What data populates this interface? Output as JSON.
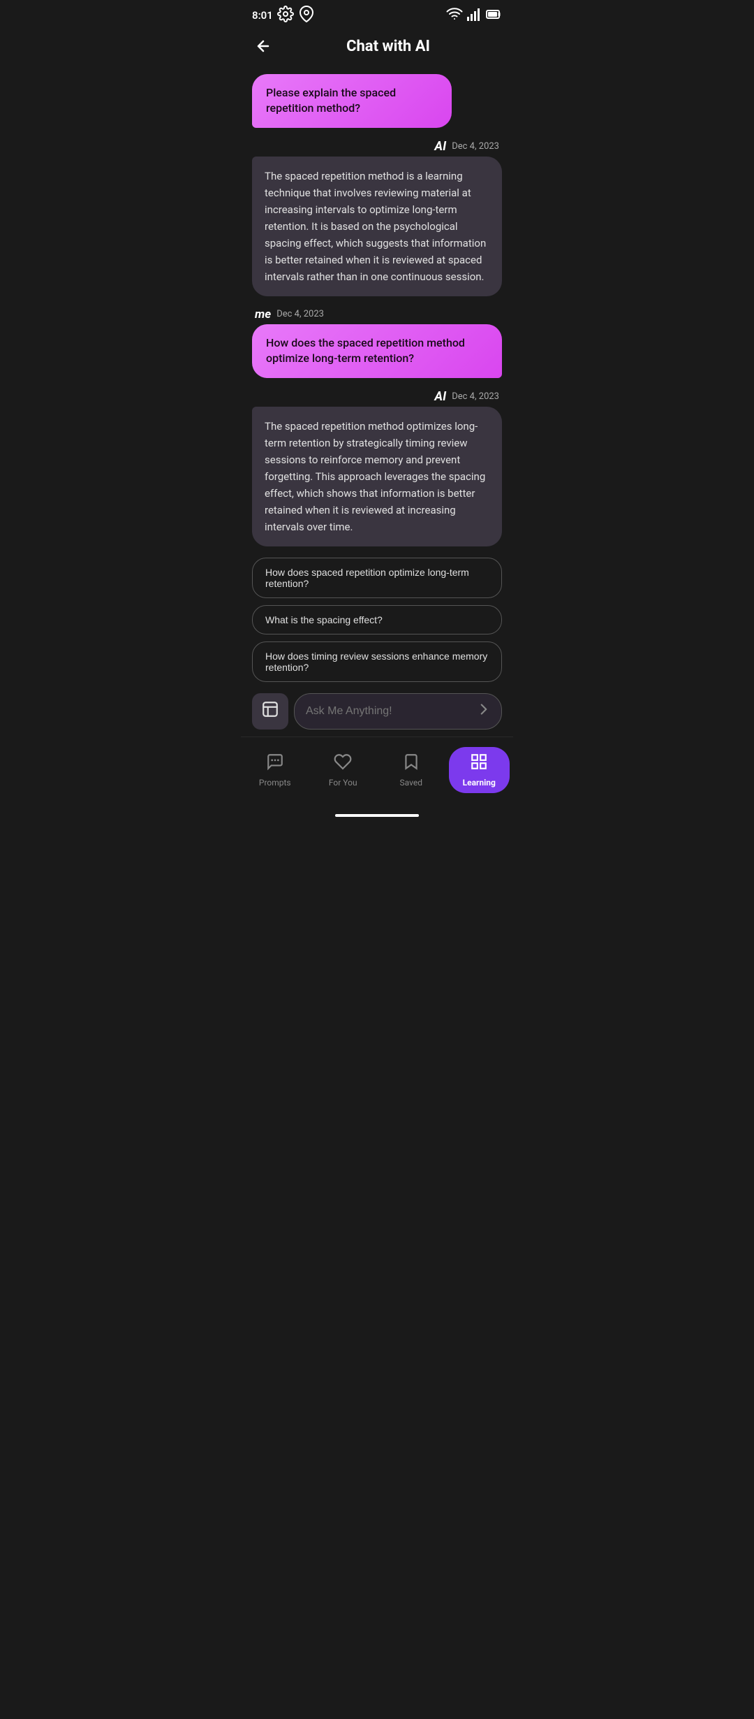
{
  "statusBar": {
    "time": "8:01",
    "icons": [
      "settings",
      "location",
      "wifi",
      "signal",
      "battery"
    ]
  },
  "header": {
    "title": "Chat with AI",
    "backLabel": "←"
  },
  "chat": [
    {
      "type": "user_first",
      "text": "Please explain the spaced repetition method?"
    },
    {
      "type": "ai",
      "sender": "AI",
      "date": "Dec 4, 2023",
      "text": "The spaced repetition method is a learning technique that involves reviewing material at increasing intervals to optimize long-term retention. It is based on the psychological spacing effect, which suggests that information is better retained when it is reviewed at spaced intervals rather than in one continuous session."
    },
    {
      "type": "me",
      "sender": "me",
      "date": "Dec 4, 2023",
      "text": "How does the spaced repetition method optimize long-term retention?"
    },
    {
      "type": "ai",
      "sender": "AI",
      "date": "Dec 4, 2023",
      "text": "The spaced repetition method optimizes long-term retention by strategically timing review sessions to reinforce memory and prevent forgetting. This approach leverages the spacing effect, which shows that information is better retained when it is reviewed at increasing intervals over time."
    }
  ],
  "suggestions": [
    "How does spaced repetition optimize long-term retention?",
    "What is the spacing effect?",
    "How does timing review sessions enhance memory retention?"
  ],
  "input": {
    "placeholder": "Ask Me Anything!"
  },
  "bottomNav": [
    {
      "id": "prompts",
      "label": "Prompts",
      "icon": "prompts"
    },
    {
      "id": "for-you",
      "label": "For You",
      "icon": "heart"
    },
    {
      "id": "saved",
      "label": "Saved",
      "icon": "bookmark"
    },
    {
      "id": "learning",
      "label": "Learning",
      "icon": "grid",
      "active": true
    }
  ]
}
